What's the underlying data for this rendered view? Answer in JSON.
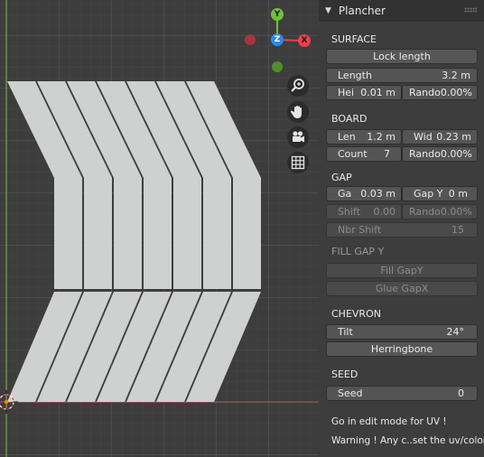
{
  "viewport": {
    "gizmo": {
      "x_label": "X",
      "y_label": "Y",
      "z_label": "Z"
    },
    "nav_icons": [
      "zoom-icon",
      "hand-pan-icon",
      "camera-icon",
      "grid-icon"
    ]
  },
  "panel": {
    "title": "Plancher",
    "surface": {
      "heading": "SURFACE",
      "lock_length": "Lock length",
      "length_label": "Length",
      "length_value": "3.2 m",
      "hei_label": "Hei",
      "hei_value": "0.01 m",
      "rando_label": "Rando",
      "rando_value": "0.00%"
    },
    "board": {
      "heading": "BOARD",
      "len_label": "Len",
      "len_value": "1.2 m",
      "wid_label": "Wid",
      "wid_value": "0.23 m",
      "count_label": "Count",
      "count_value": "7",
      "rando_label": "Rando",
      "rando_value": "0.00%"
    },
    "gap": {
      "heading": "GAP",
      "ga_label": "Ga",
      "ga_value": "0.03 m",
      "gapy_label": "Gap Y",
      "gapy_value": "0 m",
      "shift_label": "Shift",
      "shift_value": "0.00",
      "rando_label": "Rando",
      "rando_value": "0.00%",
      "nbr_shift_label": "Nbr Shift",
      "nbr_shift_value": "15"
    },
    "fill_gap_y": {
      "heading": "FILL GAP Y",
      "fill_btn": "Fill GapY",
      "glue_btn": "Glue GapX"
    },
    "chevron": {
      "heading": "CHEVRON",
      "tilt_label": "Tilt",
      "tilt_value": "24°",
      "herringbone": "Herringbone"
    },
    "seed": {
      "heading": "SEED",
      "seed_label": "Seed",
      "seed_value": "0"
    },
    "notes": {
      "edit_mode": "Go in edit mode for UV !",
      "warning": "Warning ! Any c..set the uv/color !"
    }
  },
  "colors": {
    "x_axis": "#e8424f",
    "y_axis": "#6fc03b",
    "z_axis": "#2d8ae6",
    "board": "#cfd0d0"
  }
}
